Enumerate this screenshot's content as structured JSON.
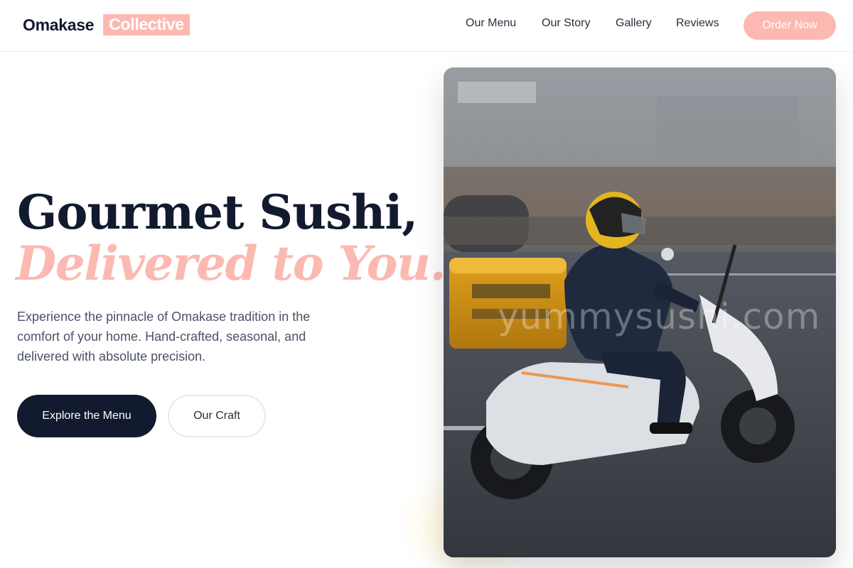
{
  "brand": {
    "name": "Omakase",
    "accent": "Collective"
  },
  "nav": {
    "links": [
      "Our Menu",
      "Our Story",
      "Gallery",
      "Reviews"
    ],
    "cta": "Order Now"
  },
  "hero": {
    "title_line1": "Gourmet Sushi,",
    "title_line2": "Delivered to You.",
    "description": "Experience the pinnacle of Omakase tradition in the comfort of your home. Hand-crafted, seasonal, and delivered with absolute precision.",
    "primary_button": "Explore the Menu",
    "secondary_button": "Our Craft",
    "image_watermark": "yummysushi.com"
  },
  "colors": {
    "brand_pink": "#fcb9b2",
    "navy": "#111a2e",
    "body_text": "#4a5266"
  },
  "icons": {
    "hero_image": "delivery-scooter-photo"
  }
}
